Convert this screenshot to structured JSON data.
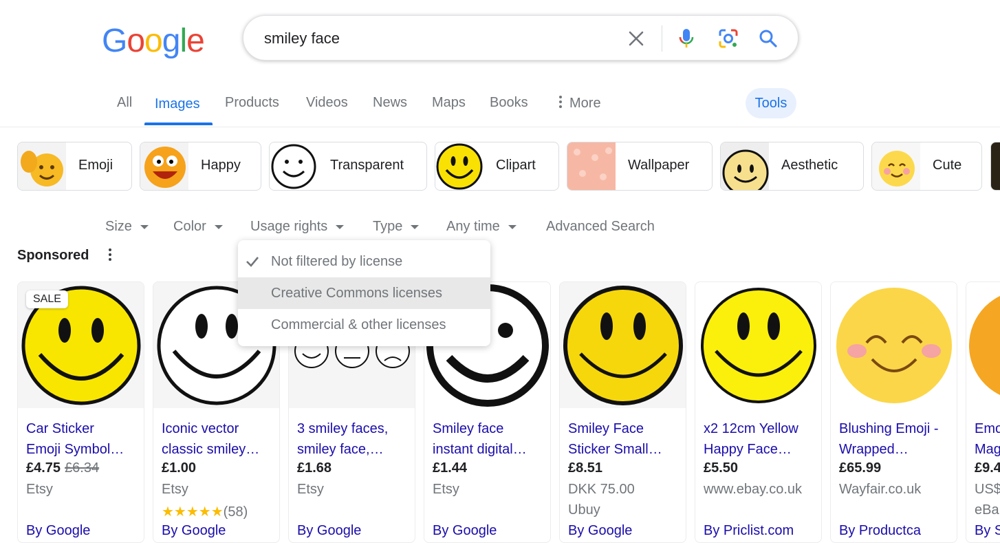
{
  "search": {
    "query": "smiley face"
  },
  "logo": {
    "letters": [
      "G",
      "o",
      "o",
      "g",
      "l",
      "e"
    ],
    "colors": [
      "#4285f4",
      "#ea4335",
      "#fbbc05",
      "#4285f4",
      "#34a853",
      "#ea4335"
    ]
  },
  "tabs": [
    {
      "label": "All"
    },
    {
      "label": "Images"
    },
    {
      "label": "Products"
    },
    {
      "label": "Videos"
    },
    {
      "label": "News"
    },
    {
      "label": "Maps"
    },
    {
      "label": "Books"
    },
    {
      "label": "More"
    }
  ],
  "tools_label": "Tools",
  "chips": [
    {
      "label": "Emoji"
    },
    {
      "label": "Happy"
    },
    {
      "label": "Transparent"
    },
    {
      "label": "Clipart"
    },
    {
      "label": "Wallpaper"
    },
    {
      "label": "Aesthetic"
    },
    {
      "label": "Cute"
    }
  ],
  "filters": [
    {
      "label": "Size"
    },
    {
      "label": "Color"
    },
    {
      "label": "Usage rights"
    },
    {
      "label": "Type"
    },
    {
      "label": "Any time"
    },
    {
      "label": "Advanced Search"
    }
  ],
  "sponsored_label": "Sponsored",
  "usage_menu": [
    {
      "label": "Not filtered by license",
      "checked": true
    },
    {
      "label": "Creative Commons licenses",
      "checked": false
    },
    {
      "label": "Commercial & other licenses",
      "checked": false
    }
  ],
  "products": [
    {
      "badge": "SALE",
      "title1": "Car Sticker",
      "title2": "Emoji Symbol…",
      "price": "£4.75",
      "old_price": "£6.34",
      "seller": "Etsy",
      "extra": "",
      "by": "By Google"
    },
    {
      "title1": "Iconic vector",
      "title2": "classic smiley…",
      "price": "£1.00",
      "seller": "Etsy",
      "stars": "★★★★★",
      "rating_count": "(58)",
      "by": "By Google"
    },
    {
      "title1": "3 smiley faces,",
      "title2": "smiley face,…",
      "price": "£1.68",
      "seller": "Etsy",
      "extra": "",
      "by": "By Google"
    },
    {
      "title1": "Smiley face",
      "title2": "instant digital…",
      "price": "£1.44",
      "seller": "Etsy",
      "extra": "",
      "by": "By Google"
    },
    {
      "title1": "Smiley Face",
      "title2": "Sticker Small…",
      "price": "£8.51",
      "seller": "DKK 75.00",
      "extra": "Ubuy",
      "by": "By Google"
    },
    {
      "title1": "x2 12cm Yellow",
      "title2": "Happy Face…",
      "price": "£5.50",
      "seller": "www.ebay.co.uk",
      "extra": "",
      "by": "By Priclist.com"
    },
    {
      "title1": "Blushing Emoji -",
      "title2": "Wrapped…",
      "price": "£65.99",
      "seller": "Wayfair.co.uk",
      "extra": "",
      "by": "By Productca"
    },
    {
      "title1": "Emo",
      "title2": "Mag",
      "price": "£9.4",
      "seller": "US$",
      "extra": "eBa",
      "by": "By S"
    }
  ]
}
